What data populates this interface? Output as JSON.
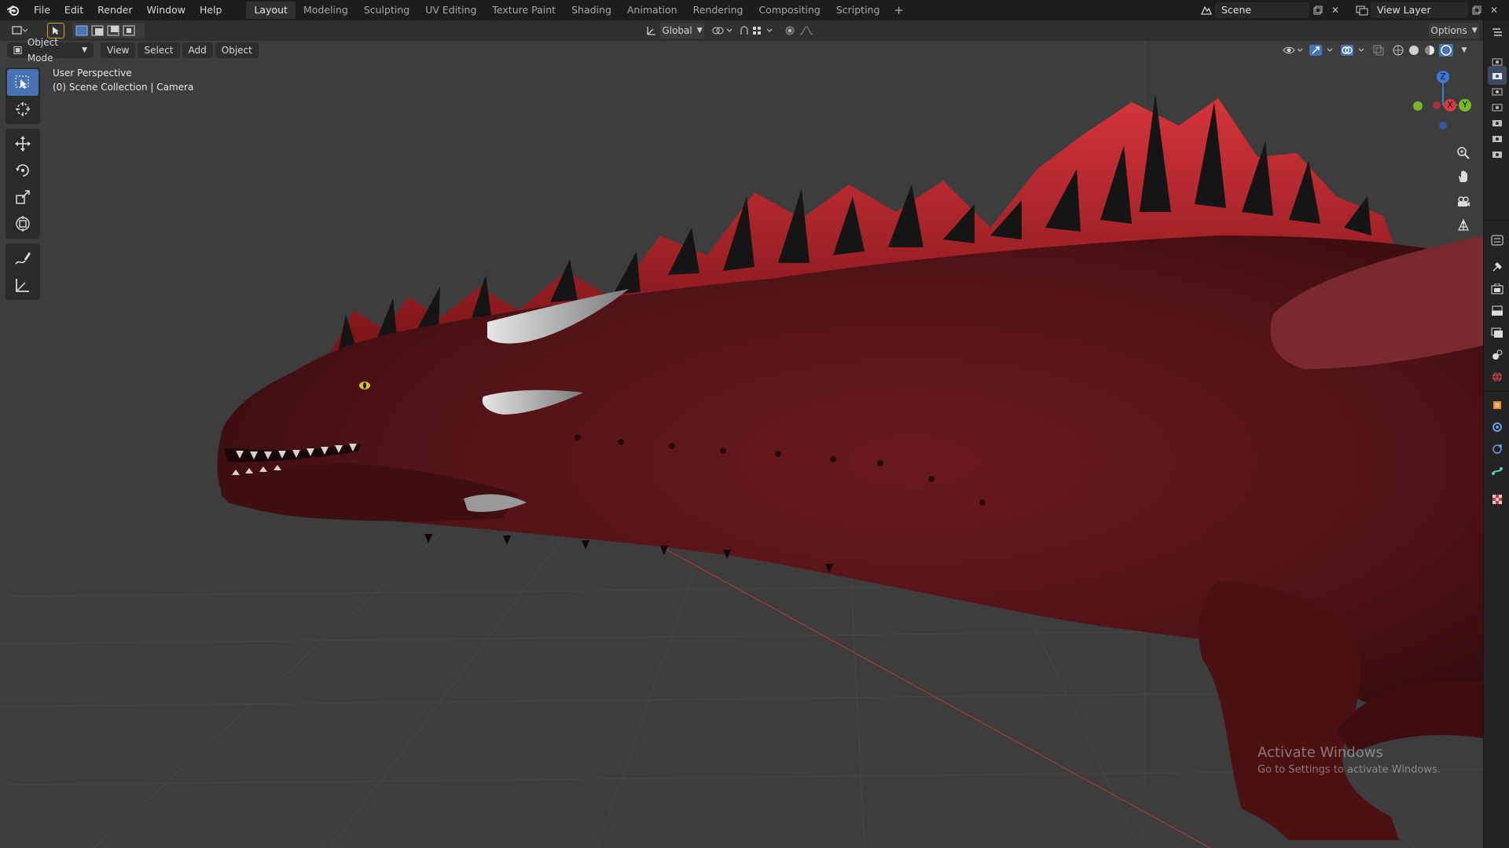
{
  "menu": {
    "items": [
      "File",
      "Edit",
      "Render",
      "Window",
      "Help"
    ]
  },
  "workspaces": {
    "tabs": [
      "Layout",
      "Modeling",
      "Sculpting",
      "UV Editing",
      "Texture Paint",
      "Shading",
      "Animation",
      "Rendering",
      "Compositing",
      "Scripting"
    ],
    "active": "Layout",
    "add_label": "+"
  },
  "scene": {
    "name": "Scene",
    "view_layer": "View Layer"
  },
  "toolheader": {
    "orientation": "Global",
    "options_label": "Options"
  },
  "viewport_header": {
    "mode": "Object Mode",
    "menus": [
      "View",
      "Select",
      "Add",
      "Object"
    ]
  },
  "viewport": {
    "perspective_label": "User Perspective",
    "collection_label": "(0) Scene Collection | Camera"
  },
  "gizmo": {
    "z": "Z",
    "x": "X",
    "y": "Y"
  },
  "watermark": {
    "title": "Activate Windows",
    "subtitle": "Go to Settings to activate Windows."
  },
  "colors": {
    "accent": "#4772b3",
    "axis_x": "#d63a48",
    "axis_y": "#77b82a",
    "axis_z": "#3b7ad6",
    "creature_body": "#5a1418",
    "creature_membrane": "#b8242b"
  }
}
